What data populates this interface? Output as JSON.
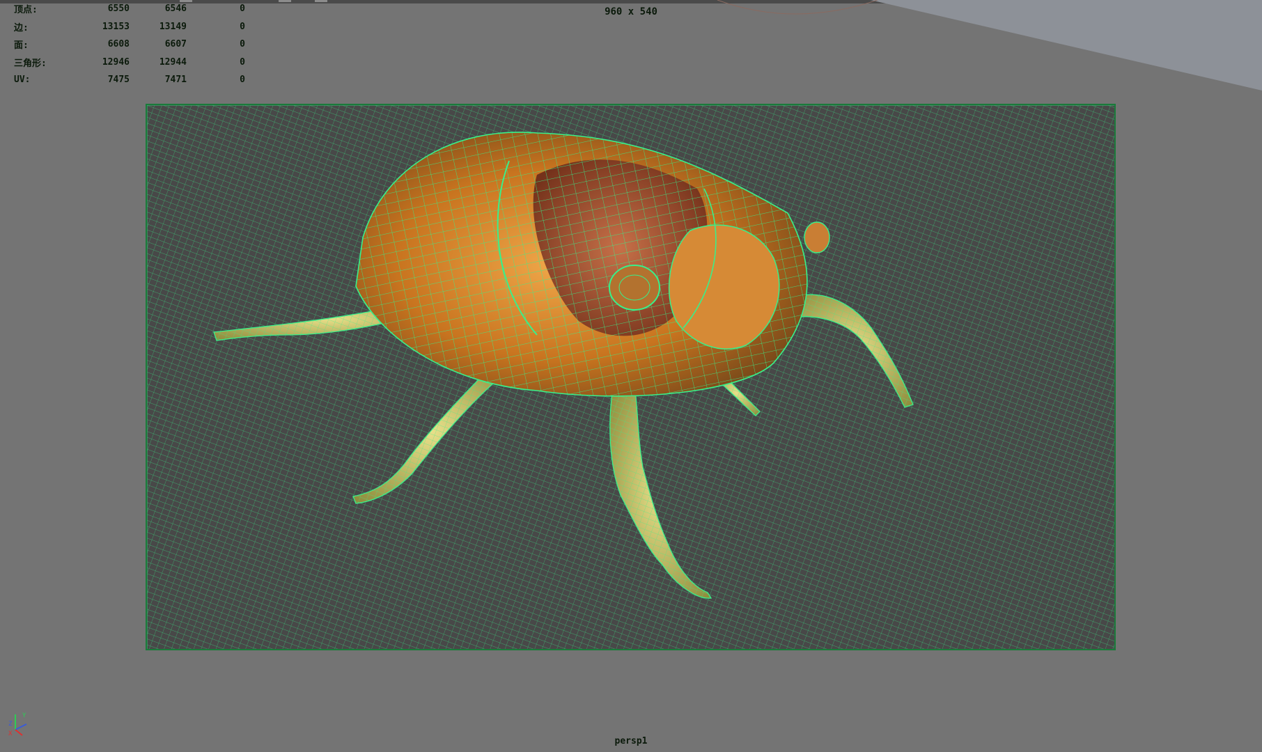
{
  "viewport": {
    "resolution_label": "960 x 540",
    "camera_label": "persp1"
  },
  "hud": {
    "rows": [
      {
        "label": "顶点:",
        "v1": "6550",
        "v2": "6546",
        "v3": "0"
      },
      {
        "label": "边:",
        "v1": "13153",
        "v2": "13149",
        "v3": "0"
      },
      {
        "label": "面:",
        "v1": "6608",
        "v2": "6607",
        "v3": "0"
      },
      {
        "label": "三角形:",
        "v1": "12946",
        "v2": "12944",
        "v3": "0"
      },
      {
        "label": "UV:",
        "v1": "7475",
        "v2": "7471",
        "v3": "0"
      }
    ]
  },
  "axis": {
    "x": "X",
    "y": "Y",
    "z": "Z"
  },
  "colors": {
    "background": "#747474",
    "gate_fill": "#484848",
    "wire": "#39f08a",
    "shell_orange": "#d8892e",
    "shell_brown": "#8a3c22"
  }
}
